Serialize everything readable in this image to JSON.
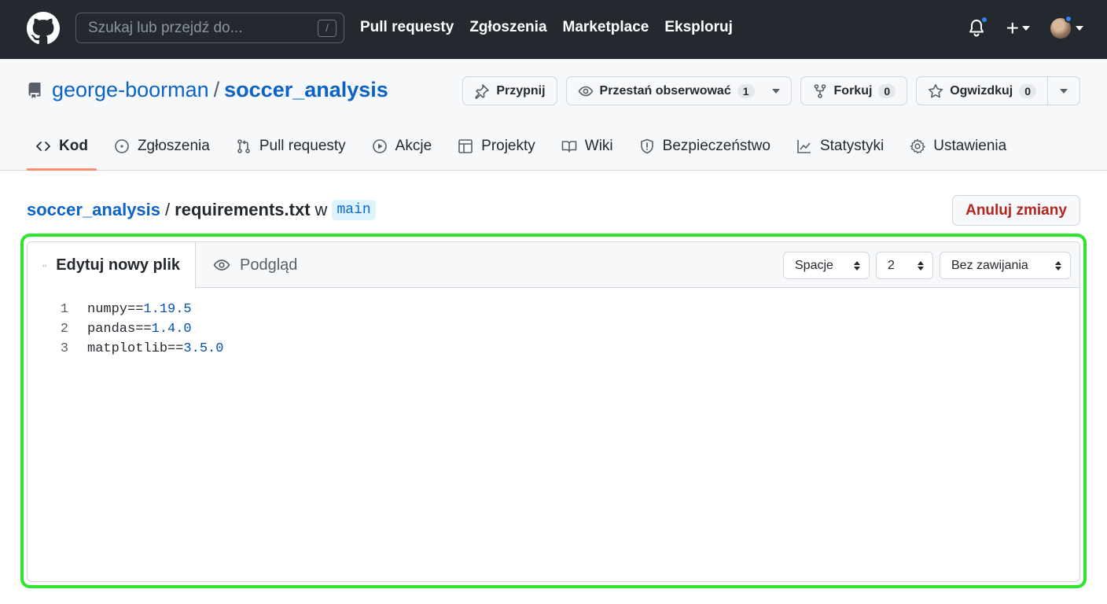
{
  "header": {
    "search_placeholder": "Szukaj lub przejdź do...",
    "search_shortcut": "/",
    "nav": [
      "Pull requesty",
      "Zgłoszenia",
      "Marketplace",
      "Eksploruj"
    ],
    "plus": "+"
  },
  "repo": {
    "owner": "george-boorman",
    "separator": "/",
    "name": "soccer_analysis",
    "actions": {
      "pin": "Przypnij",
      "watch": "Przestań obserwować",
      "watch_count": "1",
      "fork": "Forkuj",
      "fork_count": "0",
      "star": "Ogwizdkuj",
      "star_count": "0"
    },
    "tabs": [
      {
        "label": "Kod",
        "icon": "code-icon",
        "active": true
      },
      {
        "label": "Zgłoszenia",
        "icon": "issue-icon",
        "active": false
      },
      {
        "label": "Pull requesty",
        "icon": "pull-request-icon",
        "active": false
      },
      {
        "label": "Akcje",
        "icon": "play-icon",
        "active": false
      },
      {
        "label": "Projekty",
        "icon": "table-icon",
        "active": false
      },
      {
        "label": "Wiki",
        "icon": "book-icon",
        "active": false
      },
      {
        "label": "Bezpieczeństwo",
        "icon": "shield-icon",
        "active": false
      },
      {
        "label": "Statystyki",
        "icon": "graph-icon",
        "active": false
      },
      {
        "label": "Ustawienia",
        "icon": "gear-icon",
        "active": false
      }
    ]
  },
  "breadcrumb": {
    "repo": "soccer_analysis",
    "slash": "/",
    "file": "requirements.txt",
    "in": "w",
    "branch": "main"
  },
  "cancel_label": "Anuluj zmiany",
  "editor": {
    "tab_edit": "Edytuj nowy plik",
    "tab_preview": "Podgląd",
    "indent_mode": "Spacje",
    "indent_size": "2",
    "wrap_mode": "Bez zawijania",
    "lines": [
      {
        "num": "1",
        "pkg": "numpy==",
        "ver": "1.19.5"
      },
      {
        "num": "2",
        "pkg": "pandas==",
        "ver": "1.4.0"
      },
      {
        "num": "3",
        "pkg": "matplotlib==",
        "ver": "3.5.0"
      }
    ]
  },
  "colors": {
    "header_bg": "#24292f",
    "link": "#0b63c8",
    "active_tab_underline": "#fd8c73",
    "cancel_text": "#b3261e",
    "highlight_border": "#2ee52e",
    "notification_dot": "#2f81f7"
  }
}
